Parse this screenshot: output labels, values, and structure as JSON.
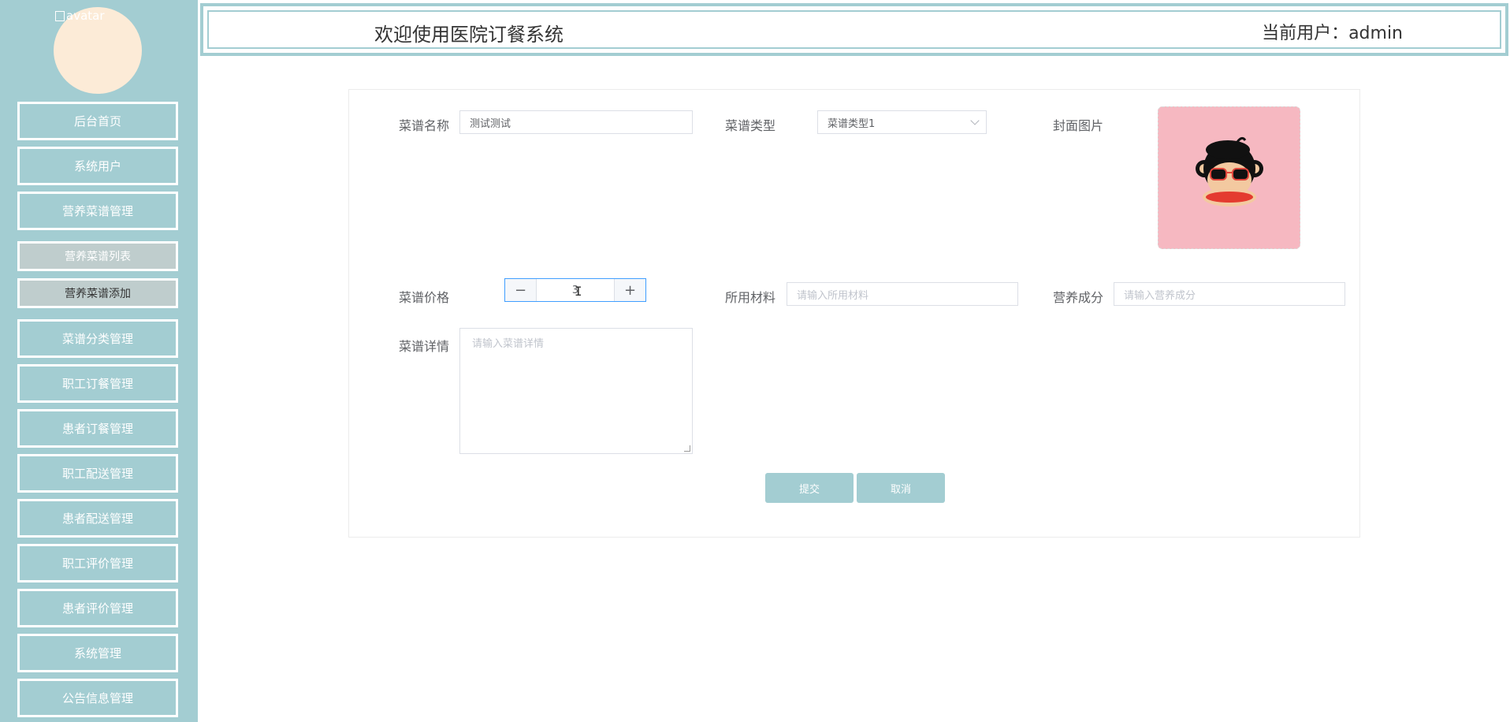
{
  "sidebar": {
    "avatar_alt": "avatar",
    "items": [
      {
        "label": "后台首页"
      },
      {
        "label": "系统用户"
      },
      {
        "label": "营养菜谱管理"
      },
      {
        "label": "营养菜谱列表"
      },
      {
        "label": "营养菜谱添加"
      },
      {
        "label": "菜谱分类管理"
      },
      {
        "label": "职工订餐管理"
      },
      {
        "label": "患者订餐管理"
      },
      {
        "label": "职工配送管理"
      },
      {
        "label": "患者配送管理"
      },
      {
        "label": "职工评价管理"
      },
      {
        "label": "患者评价管理"
      },
      {
        "label": "系统管理"
      },
      {
        "label": "公告信息管理"
      }
    ]
  },
  "header": {
    "title": "欢迎使用医院订餐系统",
    "user": "当前用户：admin"
  },
  "form": {
    "name_label": "菜谱名称",
    "name_value": "测试测试",
    "type_label": "菜谱类型",
    "type_value": "菜谱类型1",
    "cover_label": "封面图片",
    "price_label": "菜谱价格",
    "price_value": "3",
    "minus": "−",
    "plus": "+",
    "material_label": "所用材料",
    "material_placeholder": "请输入所用材料",
    "nutrition_label": "营养成分",
    "nutrition_placeholder": "请输入营养成分",
    "detail_label": "菜谱详情",
    "detail_placeholder": "请输入菜谱详情",
    "submit": "提交",
    "cancel": "取消"
  },
  "colors": {
    "theme": "#a3cdd2",
    "avatar_bg": "#fcebd7",
    "cover_bg": "#f6b8c1"
  }
}
